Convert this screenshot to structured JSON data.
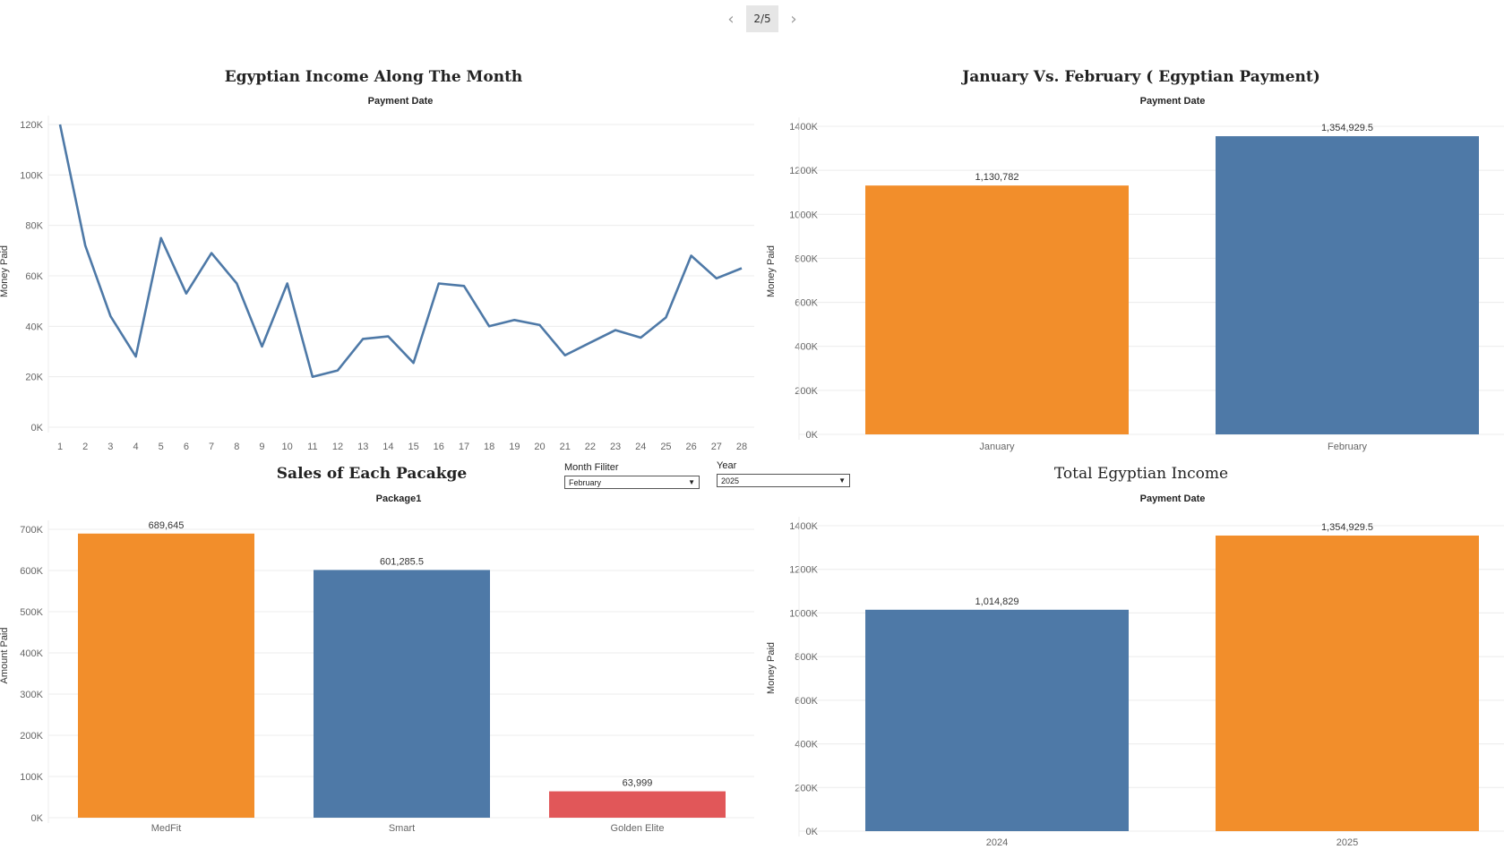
{
  "pager": {
    "label": "2/5"
  },
  "filters": {
    "month": {
      "label": "Month Filiter",
      "value": "February"
    },
    "year": {
      "label": "Year",
      "value": "2025"
    }
  },
  "chart_data": [
    {
      "id": "line",
      "type": "line",
      "title": "Egyptian Income Along The Month",
      "subtitle": "Payment Date",
      "ylabel": "Money Paid",
      "ylim": [
        0,
        120000
      ],
      "yticks": [
        "0K",
        "20K",
        "40K",
        "60K",
        "80K",
        "100K",
        "120K"
      ],
      "x": [
        1,
        2,
        3,
        4,
        5,
        6,
        7,
        8,
        9,
        10,
        11,
        12,
        13,
        14,
        15,
        16,
        17,
        18,
        19,
        20,
        21,
        22,
        23,
        24,
        25,
        26,
        27,
        28
      ],
      "values": [
        120000,
        72000,
        44000,
        28000,
        75000,
        53000,
        69000,
        57000,
        32000,
        57000,
        20000,
        22500,
        35000,
        36000,
        25500,
        57000,
        56000,
        40000,
        42500,
        40500,
        28500,
        33500,
        38500,
        35500,
        43500,
        68000,
        59000,
        63000
      ],
      "color": "#4e79a7"
    },
    {
      "id": "janfeb",
      "type": "bar",
      "title": "January Vs. February ( Egyptian Payment)",
      "subtitle": "Payment Date",
      "ylabel": "Money Paid",
      "ylim": [
        0,
        1400000
      ],
      "yticks": [
        "0K",
        "200K",
        "400K",
        "600K",
        "800K",
        "1000K",
        "1200K",
        "1400K"
      ],
      "categories": [
        "January",
        "February"
      ],
      "values": [
        1130782,
        1354929.5
      ],
      "labels": [
        "1,130,782",
        "1,354,929.5"
      ],
      "colors": [
        "#f28e2b",
        "#4e79a7"
      ]
    },
    {
      "id": "packages",
      "type": "bar",
      "title": "Sales of Each Pacakge",
      "subtitle": "Package1",
      "ylabel": "Amount Paid",
      "ylim": [
        0,
        700000
      ],
      "yticks": [
        "0K",
        "100K",
        "200K",
        "300K",
        "400K",
        "500K",
        "600K",
        "700K"
      ],
      "categories": [
        "MedFit",
        "Smart",
        "Golden Elite"
      ],
      "values": [
        689645,
        601285.5,
        63999
      ],
      "labels": [
        "689,645",
        "601,285.5",
        "63,999"
      ],
      "colors": [
        "#f28e2b",
        "#4e79a7",
        "#e15759"
      ]
    },
    {
      "id": "total",
      "type": "bar",
      "title": "Total Egyptian Income",
      "subtitle": "Payment Date",
      "ylabel": "Money Paid",
      "ylim": [
        0,
        1400000
      ],
      "yticks": [
        "0K",
        "200K",
        "400K",
        "600K",
        "800K",
        "1000K",
        "1200K",
        "1400K"
      ],
      "categories": [
        "2024",
        "2025"
      ],
      "values": [
        1014829,
        1354929.5
      ],
      "labels": [
        "1,014,829",
        "1,354,929.5"
      ],
      "colors": [
        "#4e79a7",
        "#f28e2b"
      ]
    }
  ]
}
